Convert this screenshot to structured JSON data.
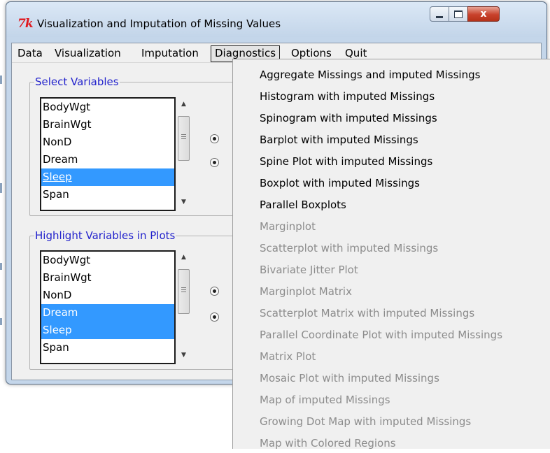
{
  "window": {
    "title": "Visualization and Imputation of Missing Values",
    "logo": "7k",
    "close_glyph": "x"
  },
  "menubar": {
    "items": [
      "Data",
      "Visualization",
      "Imputation",
      "Diagnostics",
      "Options",
      "Quit"
    ],
    "active": "Diagnostics"
  },
  "select_group": {
    "legend": "Select Variables",
    "items": [
      "BodyWgt",
      "BrainWgt",
      "NonD",
      "Dream",
      "Sleep",
      "Span"
    ],
    "selected": [
      "Sleep"
    ]
  },
  "highlight_group": {
    "legend": "Highlight Variables in Plots",
    "items": [
      "BodyWgt",
      "BrainWgt",
      "NonD",
      "Dream",
      "Sleep",
      "Span"
    ],
    "selected": [
      "Dream",
      "Sleep"
    ]
  },
  "diagnostics_menu": {
    "items": [
      {
        "label": "Aggregate Missings and imputed Missings",
        "enabled": true
      },
      {
        "label": "Histogram with imputed Missings",
        "enabled": true
      },
      {
        "label": "Spinogram with imputed Missings",
        "enabled": true
      },
      {
        "label": "Barplot with imputed Missings",
        "enabled": true
      },
      {
        "label": "Spine Plot with imputed Missings",
        "enabled": true
      },
      {
        "label": "Boxplot with imputed Missings",
        "enabled": true
      },
      {
        "label": "Parallel Boxplots",
        "enabled": true
      },
      {
        "label": "Marginplot",
        "enabled": false
      },
      {
        "label": "Scatterplot with imputed Missings",
        "enabled": false
      },
      {
        "label": "Bivariate Jitter Plot",
        "enabled": false
      },
      {
        "label": "Marginplot Matrix",
        "enabled": false
      },
      {
        "label": "Scatterplot Matrix with imputed Missings",
        "enabled": false
      },
      {
        "label": "Parallel Coordinate Plot with imputed Missings",
        "enabled": false
      },
      {
        "label": "Matrix Plot",
        "enabled": false
      },
      {
        "label": "Mosaic Plot with imputed Missings",
        "enabled": false
      },
      {
        "label": "Map of imputed Missings",
        "enabled": false
      },
      {
        "label": "Growing Dot Map with imputed Missings",
        "enabled": false
      },
      {
        "label": "Map with Colored Regions",
        "enabled": false
      }
    ]
  },
  "colors": {
    "selection": "#3399ff",
    "legend_text": "#2222cc",
    "disabled_text": "#8c8c8c"
  }
}
